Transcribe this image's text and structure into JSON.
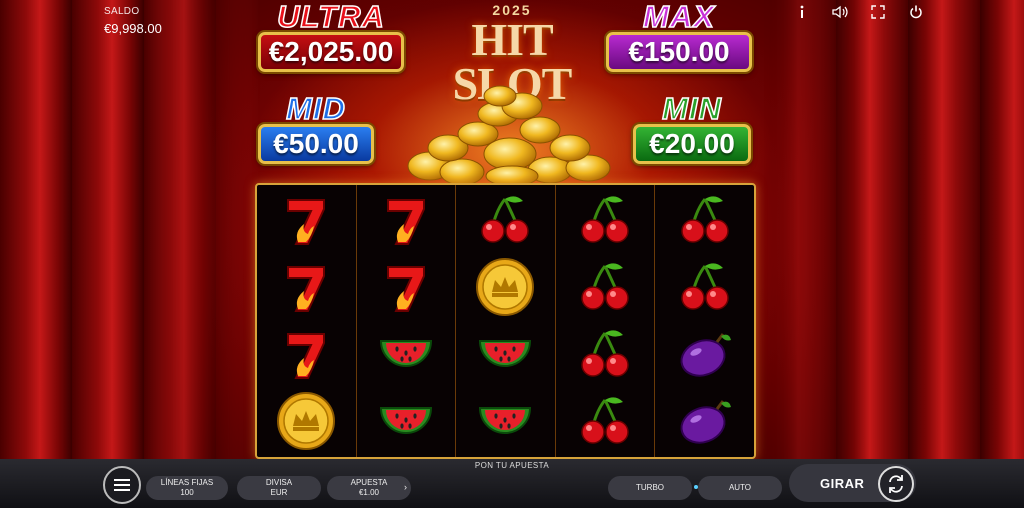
{
  "balance": {
    "label": "SALDO",
    "value": "€9,998.00"
  },
  "top_icons": [
    "info-icon",
    "sound-icon",
    "fullscreen-icon",
    "power-icon"
  ],
  "jackpots": {
    "ultra": {
      "name": "ULTRA",
      "amount": "€2,025.00",
      "color": "#e8101a"
    },
    "max": {
      "name": "MAX",
      "amount": "€150.00",
      "color": "#c832d8"
    },
    "mid": {
      "name": "MID",
      "amount": "€50.00",
      "color": "#1e6ee8"
    },
    "min": {
      "name": "MIN",
      "amount": "€20.00",
      "color": "#2aa02a"
    }
  },
  "logo": {
    "year": "2025",
    "title": "HIT SLOT"
  },
  "reels": [
    [
      "seven",
      "seven",
      "seven",
      "coin"
    ],
    [
      "seven",
      "seven",
      "watermelon",
      "watermelon"
    ],
    [
      "cherry",
      "coin",
      "watermelon",
      "watermelon"
    ],
    [
      "cherry",
      "cherry",
      "cherry",
      "cherry"
    ],
    [
      "cherry",
      "cherry",
      "plum",
      "plum"
    ]
  ],
  "bottom_bar": {
    "hint": "PON TU APUESTA",
    "lines_label": "LÍNEAS FIJAS",
    "lines_value": "100",
    "currency_label": "DIVISA",
    "currency_value": "EUR",
    "bet_label": "APUESTA",
    "bet_value": "€1.00",
    "turbo": "TURBO",
    "auto": "AUTO",
    "spin": "GIRAR"
  }
}
